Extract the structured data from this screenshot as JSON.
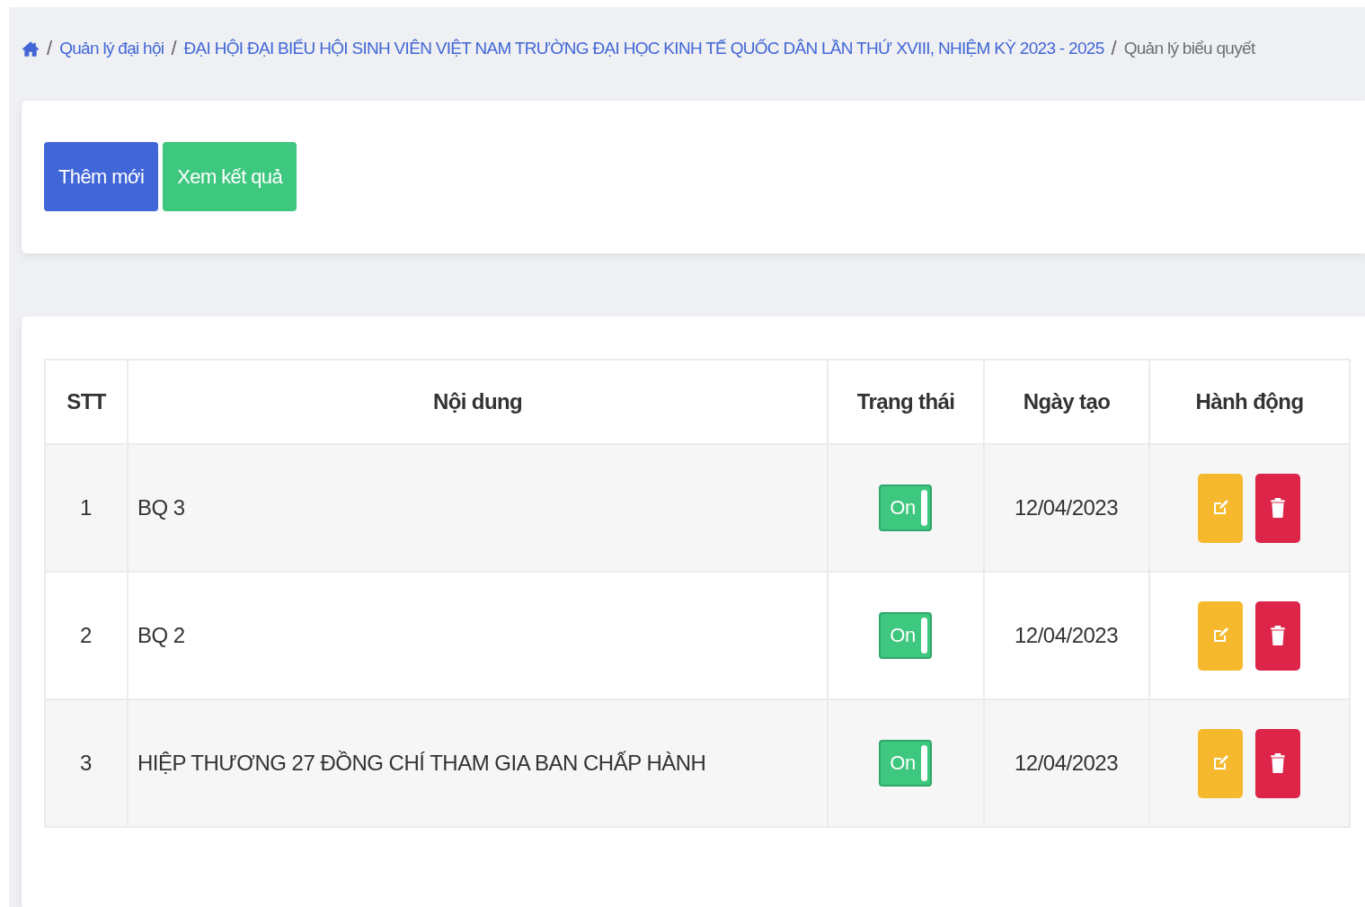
{
  "breadcrumb_separator": "/",
  "breadcrumb": [
    {
      "label": "Quản lý đại hội",
      "current": false
    },
    {
      "label": "ĐẠI HỘI ĐẠI BIỂU HỘI SINH VIÊN VIỆT NAM TRƯỜNG ĐẠI HỌC KINH TẾ QUỐC DÂN LẦN THỨ XVIII, NHIỆM KỲ 2023 - 2025",
      "current": false
    },
    {
      "label": "Quản lý biểu quyết",
      "current": true
    }
  ],
  "buttons": [
    {
      "label": "Thêm mới",
      "kind": "primary"
    },
    {
      "label": "Xem kết quả",
      "kind": "success"
    }
  ],
  "table": {
    "columns": [
      "STT",
      "Nội dung",
      "Trạng thái",
      "Ngày tạo",
      "Hành động"
    ],
    "rows": [
      {
        "stt": "1",
        "content": "BQ 3",
        "status": {
          "label": "On",
          "on": true
        },
        "date": "12/04/2023"
      },
      {
        "stt": "2",
        "content": "BQ 2",
        "status": {
          "label": "On",
          "on": true
        },
        "date": "12/04/2023"
      },
      {
        "stt": "3",
        "content": "HIỆP THƯƠNG 27 ĐỒNG CHÍ THAM GIA BAN CHẤP HÀNH",
        "status": {
          "label": "On",
          "on": true
        },
        "date": "12/04/2023"
      }
    ]
  }
}
